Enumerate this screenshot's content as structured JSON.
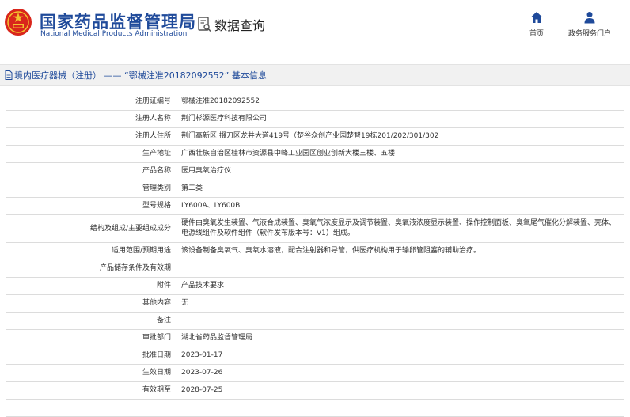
{
  "header": {
    "org_name_cn": "国家药品监督管理局",
    "org_name_en": "National Medical Products Administration",
    "section_title": "数据查询",
    "nav": [
      {
        "label": "首页",
        "icon": "home-icon"
      },
      {
        "label": "政务服务门户",
        "icon": "user-icon"
      }
    ]
  },
  "breadcrumb": {
    "text": "境内医疗器械（注册） —— “鄂械注准20182092552” 基本信息"
  },
  "table": {
    "rows": [
      {
        "label": "注册证编号",
        "value": "鄂械注准20182092552"
      },
      {
        "label": "注册人名称",
        "value": "荆门杉源医疗科技有限公司"
      },
      {
        "label": "注册人住所",
        "value": "荆门高新区·掇刀区龙井大道419号（楚谷众创产业园楚智19栋201/202/301/302"
      },
      {
        "label": "生产地址",
        "value": "广西壮族自治区桂林市资源县中峰工业园区创业创新大楼三楼、五楼"
      },
      {
        "label": "产品名称",
        "value": "医用臭氧治疗仪"
      },
      {
        "label": "管理类别",
        "value": "第二类"
      },
      {
        "label": "型号规格",
        "value": "LY600A、LY600B"
      },
      {
        "label": "结构及组成/主要组成成分",
        "value": "硬件由臭氧发生装置、气液合成装置、臭氧气浓度显示及调节装置、臭氧液浓度显示装置、操作控制面板、臭氧尾气催化分解装置、壳体、电源线组件及软件组件（软件发布版本号：V1）组成。"
      },
      {
        "label": "适用范围/预期用途",
        "value": "该设备制备臭氧气、臭氧水溶液，配合注射器和导管，供医疗机构用于输卵管阻塞的辅助治疗。"
      },
      {
        "label": "产品储存条件及有效期",
        "value": ""
      },
      {
        "label": "附件",
        "value": "产品技术要求"
      },
      {
        "label": "其他内容",
        "value": "无"
      },
      {
        "label": "备注",
        "value": ""
      },
      {
        "label": "审批部门",
        "value": "湖北省药品监督管理局"
      },
      {
        "label": "批准日期",
        "value": "2023-01-17"
      },
      {
        "label": "生效日期",
        "value": "2023-07-26"
      },
      {
        "label": "有效期至",
        "value": "2028-07-25"
      },
      {
        "label": "",
        "value": ""
      }
    ]
  },
  "colors": {
    "brand_blue": "#1f4a9a",
    "emblem_red": "#d9261c",
    "emblem_gold": "#f2c230"
  }
}
